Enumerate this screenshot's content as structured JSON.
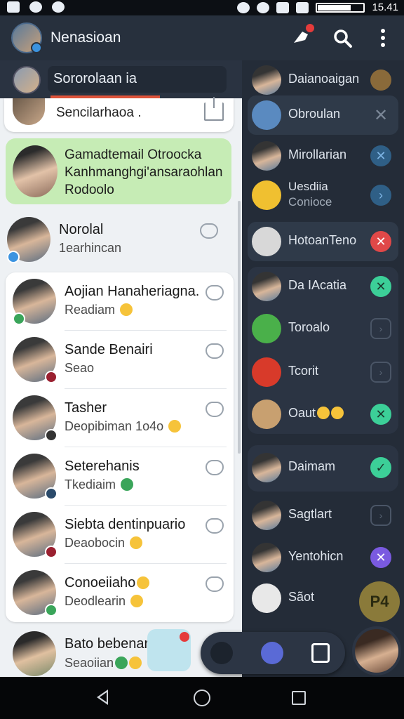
{
  "status_bar": {
    "time": "15.41"
  },
  "app_bar": {
    "title": "Nenasioan"
  },
  "search": {
    "value": "Sororolaan ia"
  },
  "top_card": {
    "text": "Sencilarhaoa ."
  },
  "pinned_chat": {
    "line1": "Gamadtemail Otroocka",
    "line2": "Kanhmanghgi'ansaraohlan",
    "line3": "Rodoolo"
  },
  "plain_chat": {
    "name": "Norolal",
    "sub": "1earhincan"
  },
  "chats": [
    {
      "name": "Aojian Hanaheriagna.",
      "sub": "Readiam"
    },
    {
      "name": "Sande Benairi",
      "sub": "Seao"
    },
    {
      "name": "Tasher",
      "sub": "Deopibiman 1o4o"
    },
    {
      "name": "Seterehanis",
      "sub": "Tkediaim"
    },
    {
      "name": "Siebta dentinpuario",
      "sub": "Deaobocin"
    },
    {
      "name": "Conoeiiaho",
      "sub": "Deodlearin"
    }
  ],
  "bottom_chat": {
    "name": "Bato bebenar",
    "sub": "Seaoiian"
  },
  "right_panel": {
    "items": [
      {
        "name": "Daianoaigan"
      },
      {
        "name": "Obroulan"
      },
      {
        "name": "Mirollarian"
      },
      {
        "name": "Uesdiia",
        "sub": "Conioce"
      },
      {
        "name": "HotoanTeno"
      },
      {
        "name": "Da IAcatia"
      },
      {
        "name": "Toroalo"
      },
      {
        "name": "Tcorit"
      },
      {
        "name": "Oaut"
      },
      {
        "name": "Daimam"
      },
      {
        "name": "Sagtlart"
      },
      {
        "name": "Yentohicn"
      },
      {
        "name": "Sãot"
      }
    ]
  },
  "fab": {
    "label": "P4"
  },
  "colors": {
    "app_bar": "#27303d",
    "left_bg": "#eef1f4",
    "right_bg": "#242c38",
    "pinned_green": "#c6ecb5",
    "badge_red": "#e53b3b"
  }
}
